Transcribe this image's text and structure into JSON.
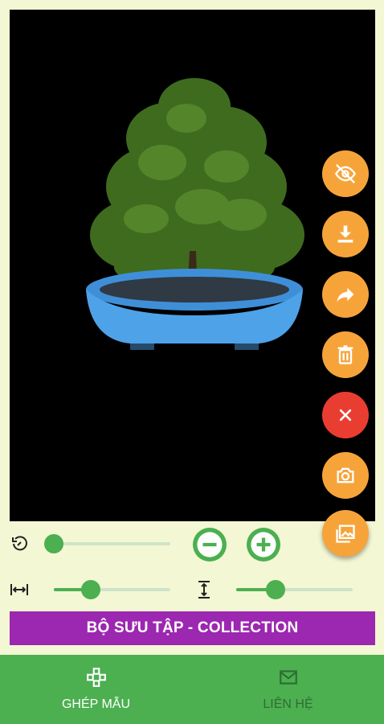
{
  "toolbar": {
    "actions": [
      {
        "icon": "eye-off-icon",
        "color": "#f6a43a"
      },
      {
        "icon": "download-icon",
        "color": "#f6a43a"
      },
      {
        "icon": "share-icon",
        "color": "#f6a43a"
      },
      {
        "icon": "trash-icon",
        "color": "#f6a43a"
      },
      {
        "icon": "close-icon",
        "color": "#ea3d32"
      },
      {
        "icon": "camera-icon",
        "color": "#f6a43a"
      },
      {
        "icon": "gallery-icon",
        "color": "#f6a43a"
      }
    ]
  },
  "controls": {
    "rotation": 0.0,
    "width": 0.32,
    "height": 0.34
  },
  "collection_button": {
    "label": "BỘ SƯU TẬP - COLLECTION",
    "color": "#9c27b0"
  },
  "bottom_nav": {
    "color": "#4caf50",
    "items": [
      {
        "label": "GHÉP MẪU",
        "icon": "gamepad-icon",
        "active": true
      },
      {
        "label": "LIÊN HỆ",
        "icon": "mail-icon",
        "active": false
      }
    ]
  }
}
